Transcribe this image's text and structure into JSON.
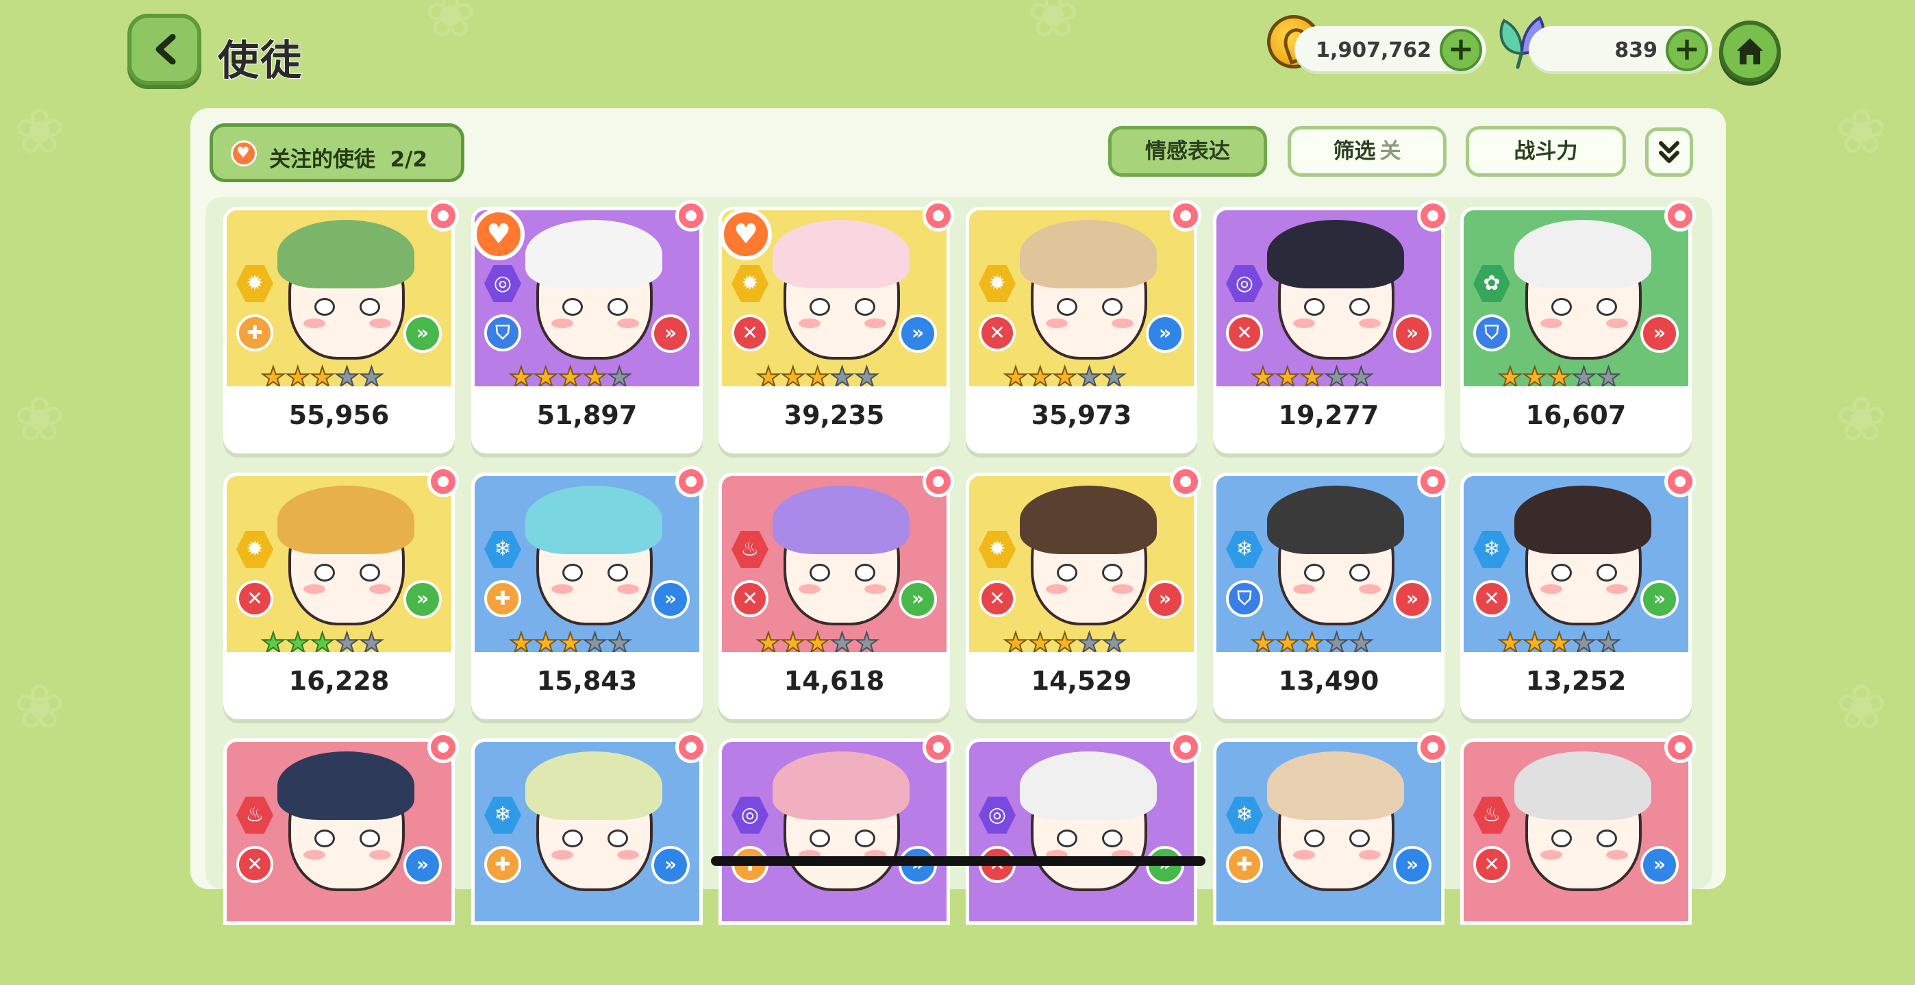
{
  "header": {
    "title": "使徒",
    "gold": "1,907,762",
    "leaf": "839",
    "plus": "+"
  },
  "toolbar": {
    "favorites_label": "关注的使徒",
    "favorites_count": "2/2",
    "emotion_label": "情感表达",
    "filter_label": "筛选",
    "filter_state": "关",
    "sort_label": "战斗力"
  },
  "colors": {
    "yellow_bg": "#f5df6e",
    "purple_bg": "#b97de8",
    "green_bg": "#6dc477",
    "blue_bg": "#78b0ec",
    "pink_bg": "#ef8a9a"
  },
  "cards": [
    {
      "power": "55,956",
      "stars": 3,
      "bg": "yellow",
      "element": "light",
      "role": "support",
      "pos": "green",
      "fav": false
    },
    {
      "power": "51,897",
      "stars": 4,
      "bg": "purple",
      "element": "dark",
      "role": "tank",
      "pos": "red",
      "fav": true
    },
    {
      "power": "39,235",
      "stars": 3,
      "bg": "yellow",
      "element": "light",
      "role": "attack",
      "pos": "blue",
      "fav": true
    },
    {
      "power": "35,973",
      "stars": 3,
      "bg": "yellow",
      "element": "light",
      "role": "attack",
      "pos": "blue",
      "fav": false
    },
    {
      "power": "19,277",
      "stars": 3,
      "bg": "purple",
      "element": "dark",
      "role": "attack",
      "pos": "red",
      "fav": false
    },
    {
      "power": "16,607",
      "stars": 3,
      "bg": "green",
      "element": "nature",
      "role": "tank",
      "pos": "red",
      "fav": false
    },
    {
      "power": "16,228",
      "stars": 3,
      "bg": "yellow",
      "element": "light",
      "role": "attack",
      "pos": "green",
      "fav": false,
      "star_color": "green"
    },
    {
      "power": "15,843",
      "stars": 3,
      "bg": "blue",
      "element": "ice",
      "role": "support",
      "pos": "blue",
      "fav": false
    },
    {
      "power": "14,618",
      "stars": 3,
      "bg": "pink",
      "element": "fire",
      "role": "attack",
      "pos": "green",
      "fav": false
    },
    {
      "power": "14,529",
      "stars": 3,
      "bg": "yellow",
      "element": "light",
      "role": "attack",
      "pos": "red",
      "fav": false
    },
    {
      "power": "13,490",
      "stars": 3,
      "bg": "blue",
      "element": "ice",
      "role": "tank",
      "pos": "red",
      "fav": false
    },
    {
      "power": "13,252",
      "stars": 3,
      "bg": "blue",
      "element": "ice",
      "role": "attack",
      "pos": "green",
      "fav": false
    },
    {
      "power": "",
      "stars": 0,
      "bg": "pink",
      "element": "fire",
      "role": "attack",
      "pos": "blue",
      "fav": false
    },
    {
      "power": "",
      "stars": 0,
      "bg": "blue",
      "element": "ice",
      "role": "support",
      "pos": "blue",
      "fav": false
    },
    {
      "power": "",
      "stars": 0,
      "bg": "purple",
      "element": "dark",
      "role": "support",
      "pos": "blue",
      "fav": false
    },
    {
      "power": "",
      "stars": 0,
      "bg": "purple",
      "element": "dark",
      "role": "attack",
      "pos": "green",
      "fav": false
    },
    {
      "power": "",
      "stars": 0,
      "bg": "blue",
      "element": "ice",
      "role": "support",
      "pos": "blue",
      "fav": false
    },
    {
      "power": "",
      "stars": 0,
      "bg": "pink",
      "element": "fire",
      "role": "attack",
      "pos": "blue",
      "fav": false
    }
  ]
}
